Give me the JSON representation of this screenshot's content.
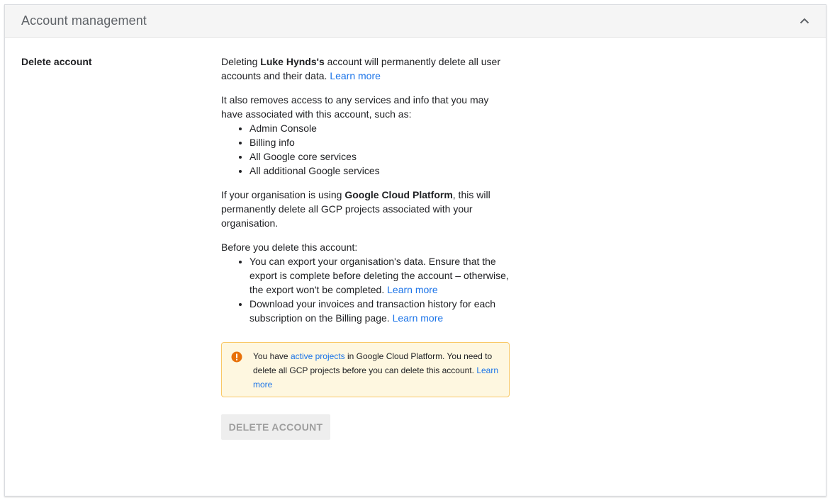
{
  "card": {
    "title": "Account management"
  },
  "section": {
    "label": "Delete account"
  },
  "intro": {
    "prefix": "Deleting ",
    "org_name": "Luke Hynds's",
    "suffix": " account will permanently delete all user accounts and their data. ",
    "learn_more": "Learn more"
  },
  "removes": {
    "text": "It also removes access to any services and info that you may have associated with this account, such as:",
    "items": [
      "Admin Console",
      "Billing info",
      "All Google core services",
      "All additional Google services"
    ]
  },
  "gcp": {
    "prefix": "If your organisation is using ",
    "platform": "Google Cloud Platform",
    "suffix": ", this will permanently delete all GCP projects associated with your organisation."
  },
  "before": {
    "intro": "Before you delete this account:",
    "items": [
      {
        "text": "You can export your organisation's data. Ensure that the export is complete before deleting the account – otherwise, the export won't be completed. ",
        "link": "Learn more"
      },
      {
        "text": "Download your invoices and transaction history for each subscription on the Billing page. ",
        "link": "Learn more"
      }
    ]
  },
  "warning": {
    "prefix": "You have ",
    "link_projects": "active projects",
    "middle": " in Google Cloud Platform. You need to delete all GCP projects before you can delete this account. ",
    "link_learn": "Learn more",
    "icon": "error-icon",
    "icon_color": "#e8710a"
  },
  "action": {
    "delete_label": "DELETE ACCOUNT"
  },
  "colors": {
    "link": "#1a73e8",
    "warning_bg": "#fef7e0",
    "warning_border": "#f9c866",
    "header_bg": "#f5f5f5"
  }
}
